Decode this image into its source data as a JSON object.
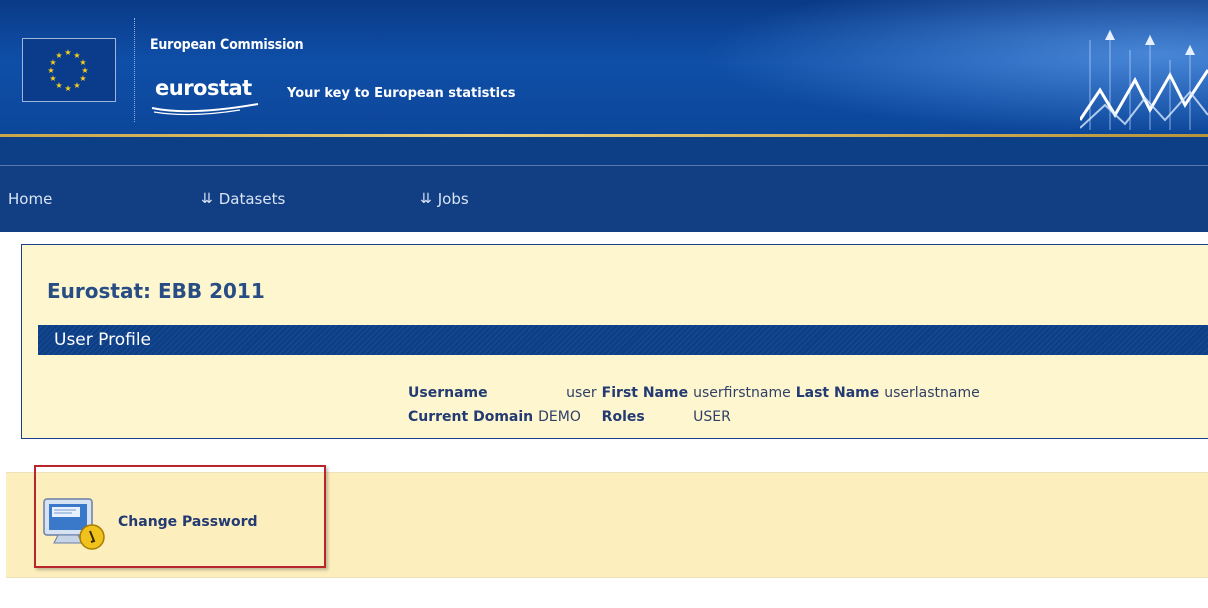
{
  "header": {
    "organization": "European Commission",
    "logo_text": "eurostat",
    "tagline": "Your key to European statistics"
  },
  "nav": {
    "items": [
      {
        "label": "Home",
        "has_chevron": false
      },
      {
        "label": "Datasets",
        "has_chevron": true
      },
      {
        "label": "Jobs",
        "has_chevron": true
      }
    ]
  },
  "main": {
    "title": "Eurostat: EBB 2011",
    "section_title": "User Profile",
    "profile": {
      "username_label": "Username",
      "username_value": "user",
      "first_name_label": "First Name",
      "first_name_value": "userfirstname",
      "last_name_label": "Last Name",
      "last_name_value": "userlastname",
      "domain_label": "Current Domain",
      "domain_value": "DEMO",
      "roles_label": "Roles",
      "roles_value": "USER"
    }
  },
  "actions": {
    "change_password_label": "Change Password",
    "change_password_icon": "computer-key-icon"
  },
  "colors": {
    "header_blue": "#0f4fa8",
    "nav_blue": "#123f84",
    "title_blue": "#284c84",
    "panel_bg": "#fdf6cf",
    "highlight_red": "#b8252a"
  }
}
